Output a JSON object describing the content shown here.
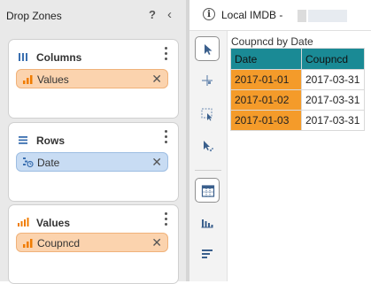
{
  "left_panel": {
    "title": "Drop Zones",
    "help_label": "?",
    "collapse_label": "‹",
    "zones": [
      {
        "title": "Columns",
        "icon": "columns-icon",
        "chip": {
          "label": "Values",
          "color": "#fbd3ae",
          "icon": "measure-values-icon"
        }
      },
      {
        "title": "Rows",
        "icon": "rows-icon",
        "chip": {
          "label": "Date",
          "color": "#c8dcf3",
          "icon": "date-hierarchy-icon"
        }
      },
      {
        "title": "Values",
        "icon": "values-icon",
        "chip": {
          "label": "Coupncd",
          "color": "#fbd3ae",
          "icon": "measure-icon"
        }
      }
    ]
  },
  "topbar": {
    "title": "Local IMDB -",
    "info_icon_label": "i"
  },
  "toolbar": {
    "tools": [
      "select-pointer-icon",
      "crosshair-icon",
      "marquee-select-icon",
      "lasso-select-icon",
      "table-view-icon",
      "chart-view-icon",
      "sort-icon"
    ],
    "active_tool": "select-pointer-icon"
  },
  "table": {
    "title": "Coupncd by Date",
    "columns": [
      "Date",
      "Coupncd"
    ],
    "rows": [
      [
        "2017-01-01",
        "2017-03-31"
      ],
      [
        "2017-01-02",
        "2017-03-31"
      ],
      [
        "2017-01-03",
        "2017-03-31"
      ]
    ],
    "header_color": "#1a8a95",
    "dimension_color": "#f49b2a"
  }
}
